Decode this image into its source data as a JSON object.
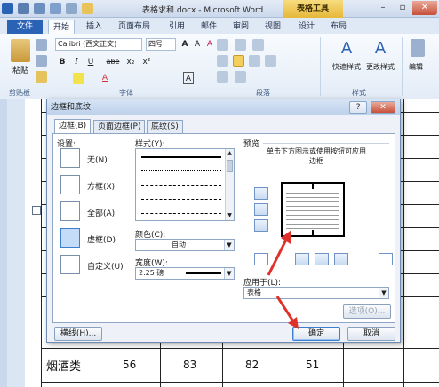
{
  "window": {
    "title": "表格求和.docx - Microsoft Word",
    "context_tab": "表格工具"
  },
  "ribbon_tabs": [
    "文件",
    "开始",
    "插入",
    "页面布局",
    "引用",
    "邮件",
    "审阅",
    "视图",
    "设计",
    "布局"
  ],
  "ribbon": {
    "paste_label": "粘贴",
    "font_name": "Calibri (西文正文)",
    "font_size": "四号",
    "group_clipboard": "剪贴板",
    "group_font": "字体",
    "group_paragraph": "段落",
    "group_styles": "样式",
    "quick_styles": "快速样式",
    "change_styles": "更改样式",
    "edit": "编辑",
    "bold": "B",
    "italic": "I",
    "underline": "U",
    "strike": "abe",
    "subscript": "x₂",
    "superscript": "x²",
    "grow_font": "A",
    "shrink_font": "A",
    "clear_format": "A",
    "font_color": "A",
    "char_border": "A",
    "style_glyph": "A"
  },
  "dialog": {
    "title": "边框和底纹",
    "help": "?",
    "close": "✕",
    "tabs": [
      "边框(B)",
      "页面边框(P)",
      "底纹(S)"
    ],
    "settings_label": "设置:",
    "settings": [
      "无(N)",
      "方框(X)",
      "全部(A)",
      "虚框(D)",
      "自定义(U)"
    ],
    "style_label": "样式(Y):",
    "color_label": "颜色(C):",
    "color_value": "自动",
    "width_label": "宽度(W):",
    "width_value": "2.25 磅",
    "preview_label": "预览",
    "preview_hint": "单击下方图示或使用按钮可应用边框",
    "apply_to_label": "应用于(L):",
    "apply_to_value": "表格",
    "options_button": "选项(O)...",
    "horizontal_line_button": "横线(H)...",
    "ok_button": "确定",
    "cancel_button": "取消"
  },
  "document": {
    "row_label": "烟酒类",
    "row_values": [
      "56",
      "83",
      "82",
      "51"
    ]
  },
  "colors": {
    "file_tab": "#2a62b5",
    "context_tab": "#e6b83a",
    "arrow": "#e0302a",
    "selected_setting": "#c4dcf7"
  }
}
